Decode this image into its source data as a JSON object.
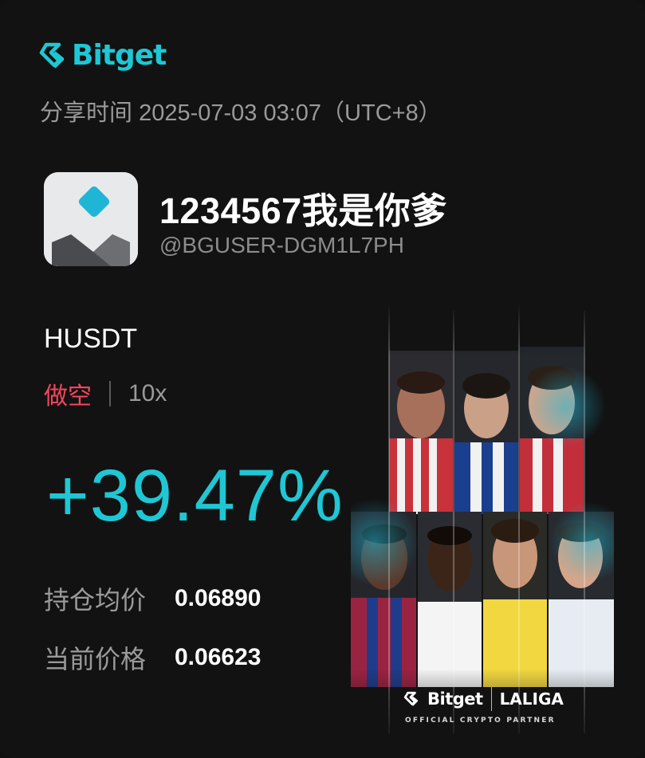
{
  "header": {
    "brand_name": "Bitget",
    "share_time_label": "分享时间",
    "share_time_value": "2025-07-03 03:07（UTC+8）",
    "brand_color": "#1fc7d4"
  },
  "user": {
    "display_name": "1234567我是你爹",
    "handle": "@BGUSER-DGM1L7PH",
    "avatar_icon": "bitget-default-avatar-icon"
  },
  "position": {
    "pair": "HUSDT",
    "side": "做空",
    "leverage": "10x",
    "pnl_percent": "+39.47%",
    "avg_price_label": "持仓均价",
    "avg_price_value": "0.06890",
    "current_price_label": "当前价格",
    "current_price_value": "0.06623"
  },
  "colors": {
    "short": "#f6465d",
    "profit": "#1fc7d4",
    "background": "#121212"
  },
  "promo": {
    "brand": "Bitget",
    "partner": "LALIGA",
    "tagline": "OFFICIAL CRYPTO PARTNER"
  }
}
